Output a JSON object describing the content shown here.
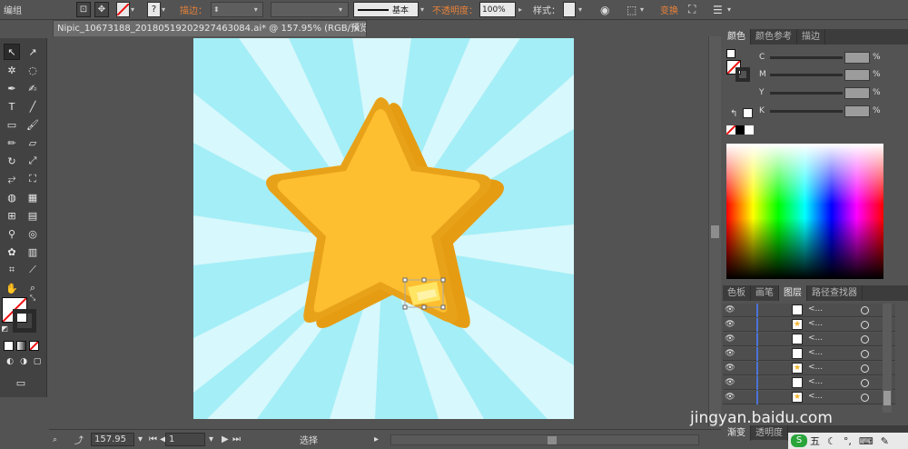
{
  "control_bar": {
    "mode_label": "编组",
    "stroke_label": "描边：",
    "stroke_profile": "基本",
    "opacity_label": "不透明度：",
    "opacity_value": "100%",
    "style_label": "样式：",
    "transform_label": "变换"
  },
  "document": {
    "tab_title": "Nipic_10673188_20180519202927463084.ai* @ 157.95% (RGB/预览)",
    "close_glyph": "×"
  },
  "status_bar": {
    "zoom": "157.95",
    "artboard_number": "1",
    "tool_status": "选择"
  },
  "color_panel": {
    "tabs": [
      "颜色",
      "颜色参考",
      "描边"
    ],
    "channels": [
      {
        "label": "C",
        "unit": "%"
      },
      {
        "label": "M",
        "unit": "%"
      },
      {
        "label": "Y",
        "unit": "%"
      },
      {
        "label": "K",
        "unit": "%"
      }
    ]
  },
  "layers_panel": {
    "tabs": [
      "色板",
      "画笔",
      "图层",
      "路径查找器"
    ],
    "rows": [
      {
        "name": "<...",
        "thumb": ""
      },
      {
        "name": "<...",
        "thumb": "★"
      },
      {
        "name": "<...",
        "thumb": ""
      },
      {
        "name": "<...",
        "thumb": ""
      },
      {
        "name": "<...",
        "thumb": "★"
      },
      {
        "name": "<...",
        "thumb": ""
      },
      {
        "name": "<...",
        "thumb": "★"
      }
    ]
  },
  "bottom_tabs": [
    "渐变",
    "透明度"
  ],
  "watermark": "jingyan.baidu.com",
  "ime_label": "五",
  "colors": {
    "sky": "#a4eef7",
    "ray": "#d7f8fc",
    "star_face": "#fdbf30",
    "star_edge": "#e69c12",
    "highlight": "#ffe563",
    "accent_orange": "#e8823a"
  }
}
